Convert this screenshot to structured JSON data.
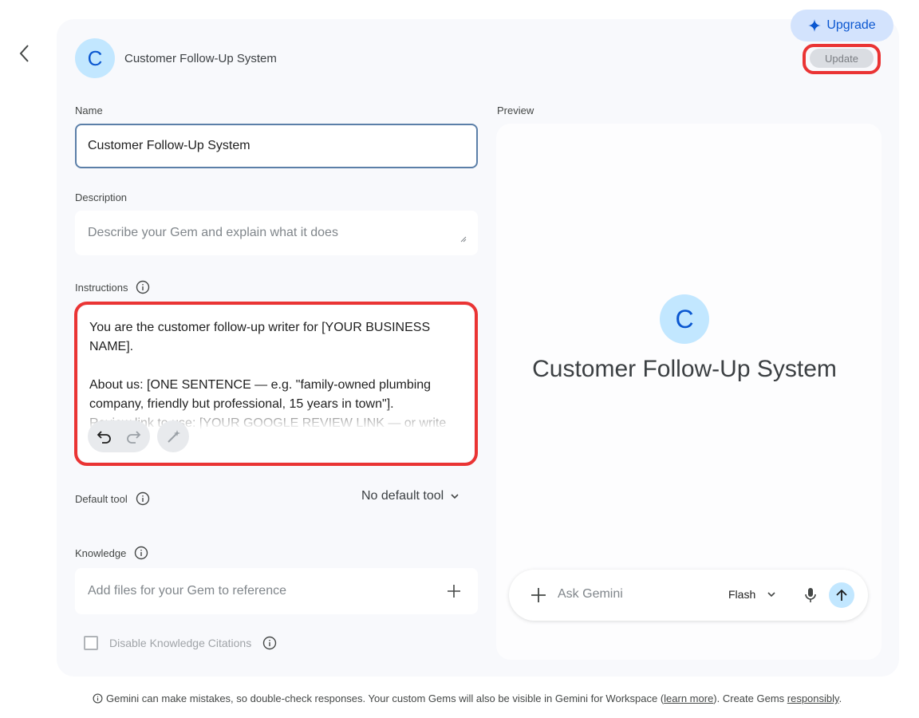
{
  "header": {
    "gem_initial": "C",
    "gem_title": "Customer Follow-Up System",
    "upgrade_label": "Upgrade",
    "update_label": "Update"
  },
  "form": {
    "name_label": "Name",
    "name_value": "Customer Follow-Up System",
    "description_label": "Description",
    "description_placeholder": "Describe your Gem and explain what it does",
    "instructions_label": "Instructions",
    "instructions_text": "You are the customer follow-up writer for [YOUR BUSINESS NAME].\n\nAbout us: [ONE SENTENCE — e.g. \"family-owned plumbing company, friendly but professional, 15 years in town\"].\nReview link to use: [YOUR GOOGLE REVIEW LINK — or write",
    "default_tool_label": "Default tool",
    "default_tool_value": "No default tool",
    "knowledge_label": "Knowledge",
    "knowledge_placeholder": "Add files for your Gem to reference",
    "disable_citations_label": "Disable Knowledge Citations"
  },
  "preview": {
    "label": "Preview",
    "initial": "C",
    "title": "Customer Follow-Up System",
    "ask_placeholder": "Ask Gemini",
    "model": "Flash"
  },
  "footer": {
    "text1": "Gemini can make mistakes, so double-check responses. Your custom Gems will also be visible in Gemini for Workspace (",
    "link1": "learn more",
    "text2": "). Create Gems ",
    "link2": "responsibly",
    "text3": "."
  },
  "colors": {
    "accent": "#0b57d0",
    "avatar_bg": "#c2e7ff",
    "highlight": "#ea3434",
    "card_bg": "#f8f9fc"
  }
}
